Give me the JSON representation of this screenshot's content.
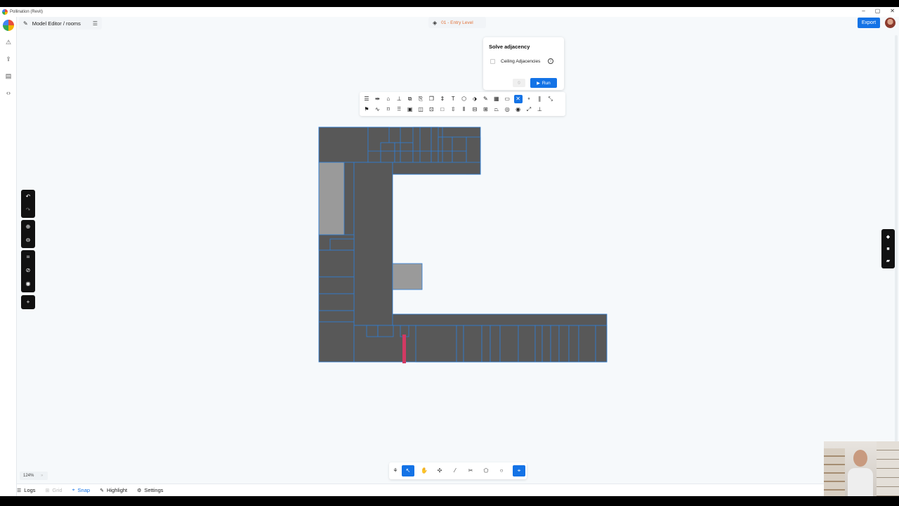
{
  "window": {
    "title": "Pollination (Revit)",
    "controls": [
      "–",
      "▢",
      "✕"
    ]
  },
  "header": {
    "breadcrumb": "Model Editor / rooms",
    "level": "01 - Entry Level",
    "export_label": "Export"
  },
  "popup": {
    "title": "Solve adjacency",
    "ceiling_label": "Ceiling Adjacencies",
    "ceiling_checked": false,
    "run_label": "Run"
  },
  "left_icons": [
    "warning-icon",
    "upload-icon",
    "file-icon",
    "code-icon"
  ],
  "toolbar": {
    "row1": [
      "align-icon",
      "align-h-icon",
      "paint-icon",
      "split-icon",
      "merge-icon",
      "copy-icon",
      "duplicate-icon",
      "align-v-icon",
      "text-icon",
      "offset-icon",
      "tag-icon",
      "edit-icon",
      "grid-icon",
      "window-icon",
      "close-icon",
      "point-icon",
      "parallel-icon",
      "scale-icon"
    ],
    "row2": [
      "flag-icon",
      "wave-icon",
      "move-icon",
      "dots-grid-icon",
      "monitor-icon",
      "columns-icon",
      "frame-icon",
      "square-icon",
      "distribute-icon",
      "vbars-icon",
      "minus-box-icon",
      "plus-box-icon",
      "trapezoid-icon",
      "target-icon",
      "eye-icon",
      "resize-icon",
      "baseline-icon"
    ],
    "active_index_row1": 14
  },
  "zoom_label": "124%",
  "statusbar": {
    "logs": "Logs",
    "grid": "Grid",
    "snap": "Snap",
    "highlight": "Highlight",
    "settings": "Settings"
  },
  "colors": {
    "accent": "#1473e6",
    "room_fill": "#585858",
    "room_outline": "#2f7fd6",
    "highlight_fill": "#9a9a9a",
    "selected_wall": "#d23a63",
    "level_text": "#e2743c"
  }
}
